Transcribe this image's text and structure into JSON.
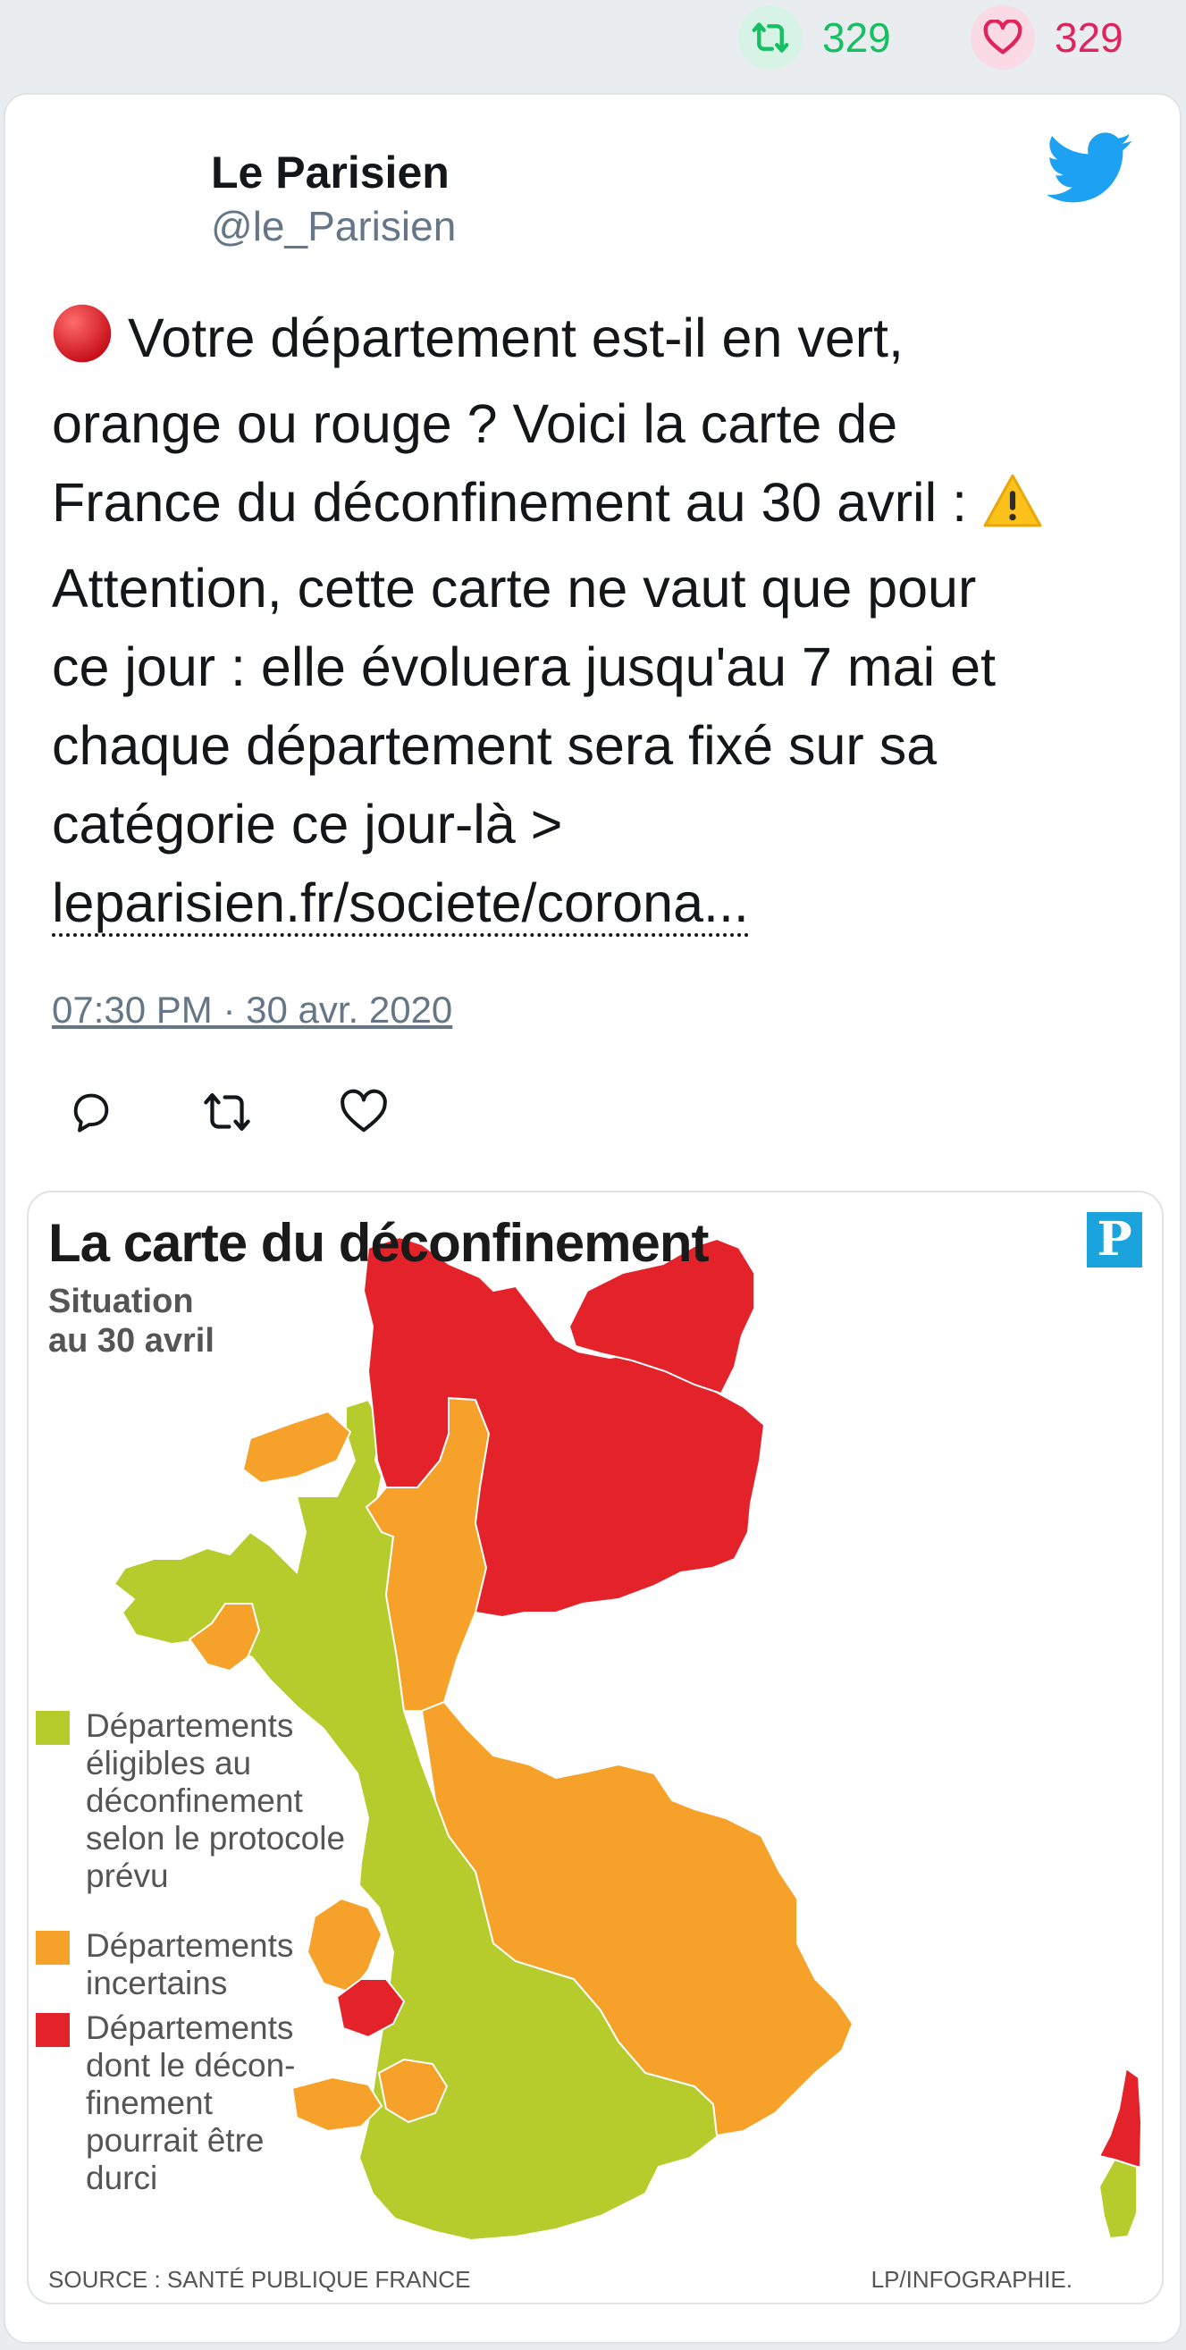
{
  "stats": {
    "retweets": "329",
    "likes": "329"
  },
  "author": {
    "name": "Le Parisien",
    "handle": "@le_Parisien"
  },
  "tweet": {
    "text_line1": " Votre département est-il en vert,",
    "text_line2": "orange ou rouge ? Voici la carte de",
    "text_line3": "France du déconfinement au 30 avril : ",
    "text_line4": "Attention, cette carte ne vaut que pour",
    "text_line5": "ce jour : elle évoluera jusqu'au 7 mai et",
    "text_line6": "chaque département sera fixé sur sa",
    "text_line7": "catégorie ce jour-là >",
    "link_text": "leparisien.fr/societe/corona...",
    "timestamp": "07:30 PM · 30 avr. 2020"
  },
  "icons": {
    "top_retweet": "retweet-icon",
    "top_like": "heart-icon",
    "bird": "twitter-bird-icon",
    "red_circle": "red-circle-emoji",
    "warning": "warning-emoji",
    "reply": "reply-icon",
    "retweet": "retweet-icon",
    "like": "like-icon"
  },
  "colors": {
    "green": "#b5cc2c",
    "orange": "#f5a12a",
    "red": "#e42229",
    "twitter_blue": "#1da1f2",
    "retweet_green": "#17bf63",
    "like_pink": "#e0245e"
  },
  "infographic": {
    "title": "La carte du déconfinement",
    "subtitle": "Situation\nau 30 avril",
    "logo_letter": "P",
    "legend": [
      {
        "label": "Départements\néligibles au\ndéconfinement\nselon le protocole\nprévu",
        "color": "#b5cc2c"
      },
      {
        "label": "Départements\nincertains",
        "color": "#f5a12a"
      },
      {
        "label": "Départements\ndont le décon-\nfinement\npourrait être\ndurci",
        "color": "#e42229"
      }
    ],
    "source": "SOURCE : SANTÉ PUBLIQUE FRANCE",
    "credit": "LP/INFOGRAPHIE."
  }
}
